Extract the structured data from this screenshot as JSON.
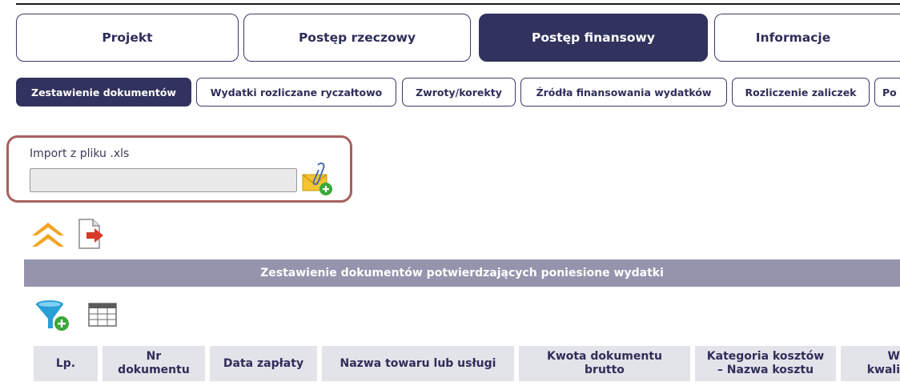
{
  "main_tabs": [
    {
      "label": "Projekt",
      "active": false
    },
    {
      "label": "Postęp rzeczowy",
      "active": false
    },
    {
      "label": "Postęp finansowy",
      "active": true
    },
    {
      "label": "Informacje",
      "active": false
    }
  ],
  "sub_tabs": [
    {
      "label": "Zestawienie dokumentów",
      "active": true
    },
    {
      "label": "Wydatki rozliczane ryczałtowo",
      "active": false
    },
    {
      "label": "Zwroty/korekty",
      "active": false
    },
    {
      "label": "Źródła finansowania wydatków",
      "active": false
    },
    {
      "label": "Rozliczenie zaliczek",
      "active": false
    },
    {
      "label": "Po",
      "active": false
    }
  ],
  "import": {
    "label": "Import z pliku .xls",
    "value": "",
    "icon": "attach-envelope-add-icon"
  },
  "toolbar_icons": [
    "collapse-up-icon",
    "export-document-icon",
    "add-filter-icon",
    "table-view-icon"
  ],
  "table": {
    "title": "Zestawienie dokumentów potwierdzających poniesione wydatki",
    "columns": [
      "Lp.",
      "Nr\ndokumentu",
      "Data zapłaty",
      "Nazwa towaru lub usługi",
      "Kwota dokumentu\nbrutto",
      "Kategoria kosztów\n– Nazwa kosztu",
      "W\nkwali"
    ]
  },
  "colors": {
    "accent": "#32325f",
    "header_bar": "#9494ad",
    "column_header": "#e3e3ea",
    "highlight_border": "#a86060"
  }
}
